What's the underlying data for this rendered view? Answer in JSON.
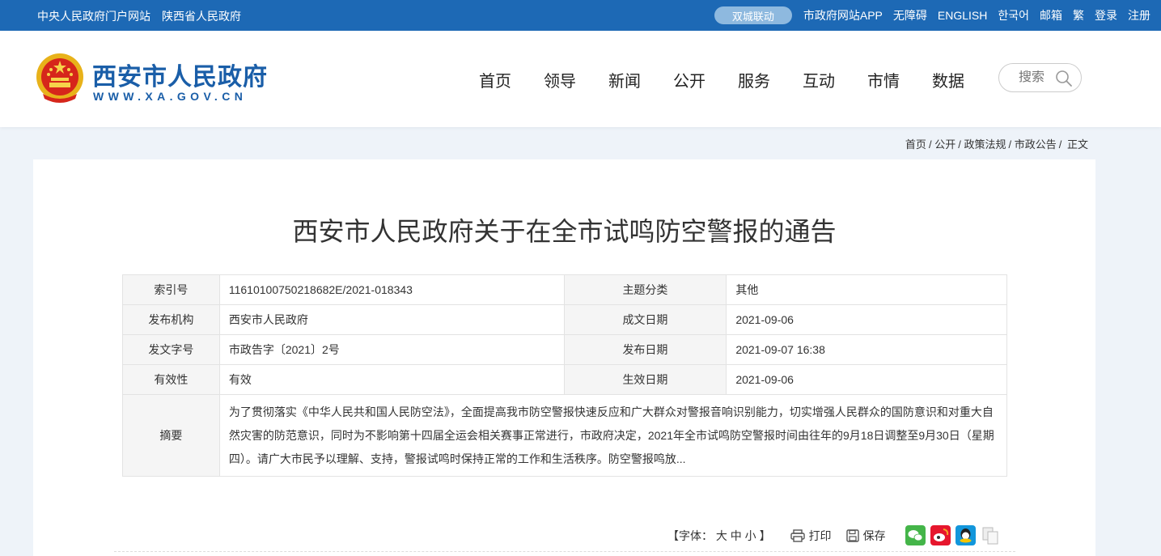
{
  "topbar": {
    "left_links": [
      "中央人民政府门户网站",
      "陕西省人民政府"
    ],
    "pill": "双城联动",
    "right_links": [
      "市政府网站APP",
      "无障碍",
      "ENGLISH",
      "한국어",
      "邮箱",
      "繁",
      "登录",
      "注册"
    ]
  },
  "header": {
    "title": "西安市人民政府",
    "url": "WWW.XA.GOV.CN",
    "nav": [
      "首页",
      "领导",
      "新闻",
      "公开",
      "服务",
      "互动",
      "市情",
      "数据"
    ],
    "search_placeholder": "搜索"
  },
  "breadcrumb": [
    "首页",
    "公开",
    "政策法规",
    "市政公告",
    "正文"
  ],
  "article": {
    "title": "西安市人民政府关于在全市试鸣防空警报的通告",
    "meta": [
      {
        "l1": "索引号",
        "v1": "11610100750218682E/2021-018343",
        "l2": "主题分类",
        "v2": "其他"
      },
      {
        "l1": "发布机构",
        "v1": "西安市人民政府",
        "l2": "成文日期",
        "v2": "2021-09-06"
      },
      {
        "l1": "发文字号",
        "v1": "市政告字〔2021〕2号",
        "l2": "发布日期",
        "v2": "2021-09-07 16:38"
      },
      {
        "l1": "有效性",
        "v1": "有效",
        "l2": "生效日期",
        "v2": "2021-09-06"
      }
    ],
    "abstract_label": "摘要",
    "abstract": "为了贯彻落实《中华人民共和国人民防空法》，全面提高我市防空警报快速反应和广大群众对警报音响识别能力，切实增强人民群众的国防意识和对重大自然灾害的防范意识，同时为不影响第十四届全运会相关赛事正常进行，市政府决定，2021年全市试鸣防空警报时间由往年的9月18日调整至9月30日（星期四）。请广大市民予以理解、支持，警报试鸣时保持正常的工作和生活秩序。防空警报鸣放..."
  },
  "tools": {
    "font_prefix": "【字体：",
    "font_large": "大",
    "font_medium": "中",
    "font_small": "小",
    "font_suffix": "】",
    "print": "打印",
    "save": "保存"
  },
  "colors": {
    "topbar": "#1d69b5",
    "brand": "#1a5ea8",
    "page_bg": "#eef3f9"
  }
}
